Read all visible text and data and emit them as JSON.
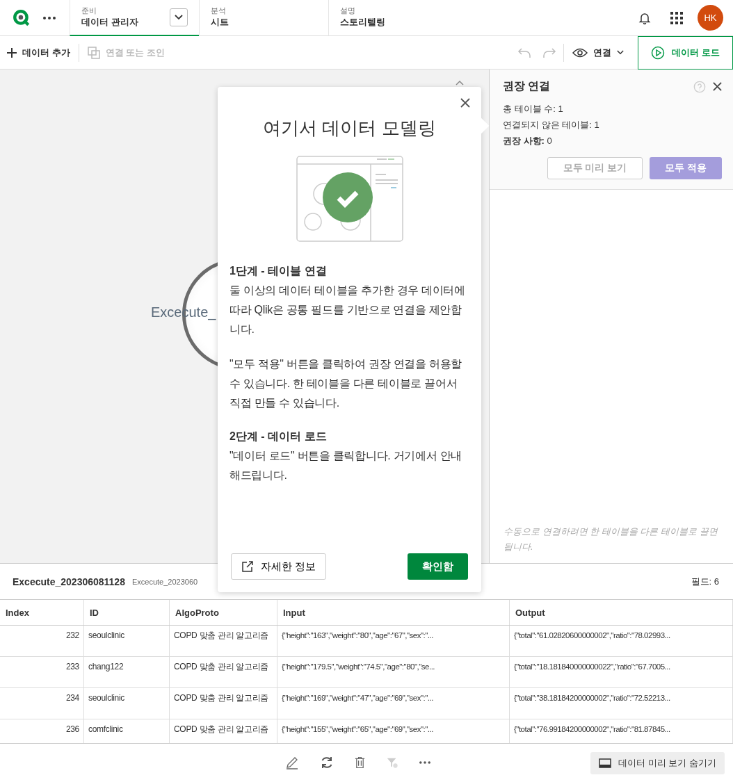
{
  "topbar": {
    "tabs": [
      {
        "category": "준비",
        "label": "데이터 관리자",
        "selected": true,
        "dropdown": true
      },
      {
        "category": "분석",
        "label": "시트",
        "selected": false,
        "dropdown": false
      },
      {
        "category": "설명",
        "label": "스토리텔링",
        "selected": false,
        "dropdown": false
      }
    ],
    "avatar": "HK"
  },
  "toolbar": {
    "add_data": "데이터 추가",
    "associate": {
      "label": "연결 또는 조인",
      "disabled": true
    },
    "view": "연결",
    "load": "데이터 로드"
  },
  "canvas": {
    "table_node": "Excecute_"
  },
  "popup": {
    "title": "여기서 데이터 모델링",
    "steps": [
      {
        "heading": "1단계 - 테이블 연결",
        "paragraphs": [
          "둘 이상의 데이터 테이블을 추가한 경우 데이터에 따라 Qlik은 공통 필드를 기반으로 연결을 제안합니다.",
          "\"모두 적용\" 버튼을 클릭하여 권장 연결을 허용할 수 있습니다. 한 테이블을 다른 테이블로 끌어서 직접 만들 수 있습니다."
        ]
      },
      {
        "heading": "2단계 - 데이터 로드",
        "paragraphs": [
          "\"데이터 로드\" 버튼을 클릭합니다. 거기에서 안내해드립니다."
        ]
      }
    ],
    "more_info": "자세한 정보",
    "ok": "확인함"
  },
  "panel": {
    "title": "권장 연결",
    "stats": [
      "총 테이블 수: 1",
      "연결되지 않은 테이블: 1",
      "**권장 사항:** 0"
    ],
    "buttons": [
      {
        "label": "모두 미리 보기",
        "kind": "outline"
      },
      {
        "label": "모두 적용",
        "kind": "primary"
      }
    ],
    "hint": "수동으로 연결하려면 한 테이블을 다른 테이블로 끌면 됩니다."
  },
  "preview": {
    "table_name": "Excecute_202306081128",
    "subtitle": "Excecute_2023060",
    "field_count": "필드: 6",
    "table": {
      "columns": [
        "Index",
        "ID",
        "AlgoProto",
        "Input",
        "Output"
      ],
      "rows": [
        [
          "232",
          "seoulclinic",
          "COPD 맞춤 관리 알고리즘",
          "{\"height\":\"163\",\"weight\":\"80\",\"age\":\"67\",\"sex\":\"...",
          "{\"total\":\"61.02820600000002\",\"ratio\":\"78.02993..."
        ],
        [
          "233",
          "chang122",
          "COPD 맞춤 관리 알고리즘",
          "{\"height\":\"179.5\",\"weight\":\"74.5\",\"age\":\"80\",\"se...",
          "{\"total\":\"18.181840000000022\",\"ratio\":\"67.7005..."
        ],
        [
          "234",
          "seoulclinic",
          "COPD 맞춤 관리 알고리즘",
          "{\"height\":\"169\",\"weight\":\"47\",\"age\":\"69\",\"sex\":\"...",
          "{\"total\":\"38.18184200000002\",\"ratio\":\"72.52213..."
        ],
        [
          "236",
          "comfclinic",
          "COPD 맞춤 관리 알고리즘",
          "{\"height\":\"155\",\"weight\":\"65\",\"age\":\"69\",\"sex\":\"...",
          "{\"total\":\"76.99184200000002\",\"ratio\":\"81.87845..."
        ]
      ]
    }
  },
  "footer": {
    "toggle": "데이터 미리 보기 숨기기"
  }
}
